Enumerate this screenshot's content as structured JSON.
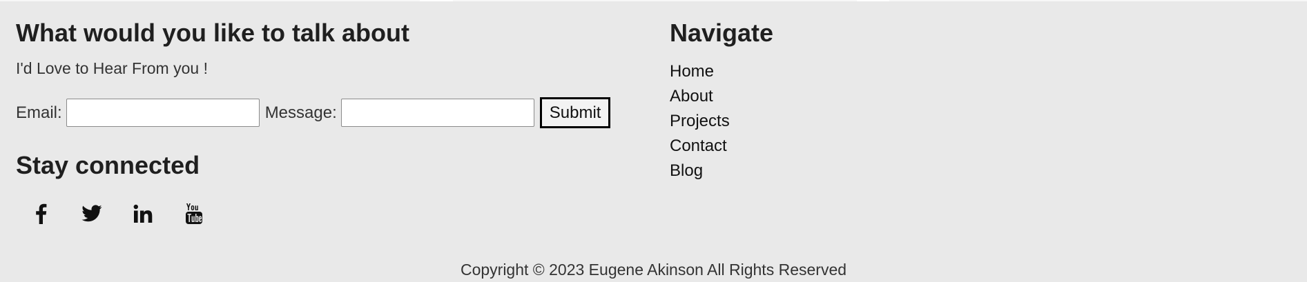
{
  "contact": {
    "heading": "What would you like to talk about",
    "subtext": "I'd Love to Hear From you !",
    "email_label": "Email:",
    "email_value": "",
    "message_label": "Message:",
    "message_value": "",
    "submit_label": "Submit"
  },
  "social": {
    "heading": "Stay connected",
    "icons": [
      "facebook-icon",
      "twitter-icon",
      "linkedin-icon",
      "youtube-icon"
    ]
  },
  "navigate": {
    "heading": "Navigate",
    "items": [
      "Home",
      "About",
      "Projects",
      "Contact",
      "Blog"
    ]
  },
  "footer": {
    "copyright": "Copyright © 2023 Eugene Akinson All Rights Reserved"
  },
  "colors": {
    "background": "#e9e9e9",
    "text": "#222222",
    "button_border": "#000000"
  }
}
